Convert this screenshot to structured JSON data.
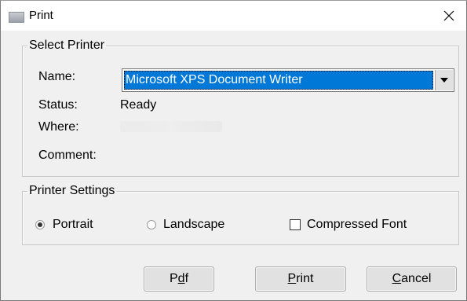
{
  "window": {
    "title": "Print",
    "close_glyph": "close-icon"
  },
  "select_printer": {
    "legend": "Select Printer",
    "name_label": "Name:",
    "name_value": "Microsoft XPS Document Writer",
    "status_label": "Status:",
    "status_value": "Ready",
    "where_label": "Where:",
    "where_value": "",
    "comment_label": "Comment:",
    "comment_value": ""
  },
  "printer_settings": {
    "legend": "Printer Settings",
    "portrait_label": "Portrait",
    "portrait_checked": true,
    "landscape_label": "Landscape",
    "landscape_checked": false,
    "compressed_label": "Compressed Font",
    "compressed_checked": false
  },
  "buttons": {
    "pdf_pre": "P",
    "pdf_mnemonic": "d",
    "pdf_post": "f",
    "print_pre": "",
    "print_mnemonic": "P",
    "print_post": "rint",
    "cancel_pre": "",
    "cancel_mnemonic": "C",
    "cancel_post": "ancel"
  },
  "colors": {
    "selection": "#0078d7",
    "dialog_bg": "#f0f0f0",
    "button_bg": "#e1e1e1"
  }
}
